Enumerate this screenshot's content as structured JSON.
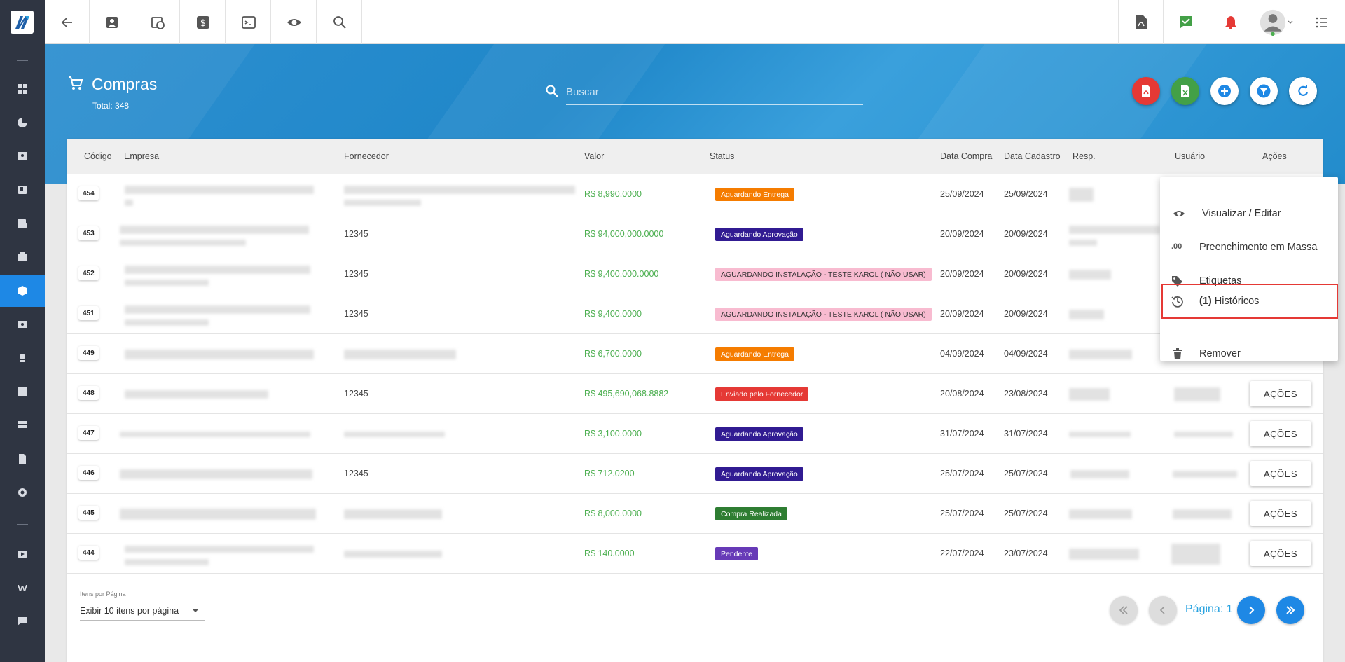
{
  "header": {
    "title": "Compras",
    "total": "Total: 348",
    "search_placeholder": "Buscar"
  },
  "table": {
    "columns": [
      "Código",
      "Empresa",
      "Fornecedor",
      "Valor",
      "Status",
      "Data Compra",
      "Data Cadastro",
      "Resp.",
      "Usuário",
      "Ações"
    ],
    "rows": [
      {
        "code": "454",
        "fornecedor": "",
        "valor": "R$ 8,990.0000",
        "status": "Aguardando Entrega",
        "data_compra": "25/09/2024",
        "data_cadastro": "25/09/2024",
        "acoes": ""
      },
      {
        "code": "453",
        "fornecedor": "12345",
        "valor": "R$ 94,000,000.0000",
        "status": "Aguardando Aprovação",
        "data_compra": "20/09/2024",
        "data_cadastro": "20/09/2024",
        "acoes": ""
      },
      {
        "code": "452",
        "fornecedor": "12345",
        "valor": "R$ 9,400,000.0000",
        "status": "AGUARDANDO INSTALAÇÃO - TESTE KAROL ( NÃO USAR)",
        "data_compra": "20/09/2024",
        "data_cadastro": "20/09/2024",
        "acoes": ""
      },
      {
        "code": "451",
        "fornecedor": "12345",
        "valor": "R$ 9,400.0000",
        "status": "AGUARDANDO INSTALAÇÃO - TESTE KAROL ( NÃO USAR)",
        "data_compra": "20/09/2024",
        "data_cadastro": "20/09/2024",
        "acoes": ""
      },
      {
        "code": "449",
        "fornecedor": "",
        "valor": "R$ 6,700.0000",
        "status": "Aguardando Entrega",
        "data_compra": "04/09/2024",
        "data_cadastro": "04/09/2024",
        "acoes": ""
      },
      {
        "code": "448",
        "fornecedor": "12345",
        "valor": "R$ 495,690,068.8882",
        "status": "Enviado pelo Fornecedor",
        "data_compra": "20/08/2024",
        "data_cadastro": "23/08/2024",
        "acoes": "AÇÕES"
      },
      {
        "code": "447",
        "fornecedor": "",
        "valor": "R$ 3,100.0000",
        "status": "Aguardando Aprovação",
        "data_compra": "31/07/2024",
        "data_cadastro": "31/07/2024",
        "acoes": "AÇÕES"
      },
      {
        "code": "446",
        "fornecedor": "12345",
        "valor": "R$ 712.0200",
        "status": "Aguardando Aprovação",
        "data_compra": "25/07/2024",
        "data_cadastro": "25/07/2024",
        "acoes": "AÇÕES"
      },
      {
        "code": "445",
        "fornecedor": "",
        "valor": "R$ 8,000.0000",
        "status": "Compra Realizada",
        "data_compra": "25/07/2024",
        "data_cadastro": "25/07/2024",
        "acoes": "AÇÕES"
      },
      {
        "code": "444",
        "fornecedor": "",
        "valor": "R$ 140.0000",
        "status": "Pendente",
        "data_compra": "22/07/2024",
        "data_cadastro": "23/07/2024",
        "acoes": "AÇÕES"
      }
    ]
  },
  "status_colors": {
    "Aguardando Entrega": {
      "bg": "#f57c00",
      "fg": "#ffffff"
    },
    "Aguardando Aprovação": {
      "bg": "#311b92",
      "fg": "#ffffff"
    },
    "AGUARDANDO INSTALAÇÃO - TESTE KAROL ( NÃO USAR)": {
      "bg": "#f8bbd0",
      "fg": "#333333"
    },
    "Enviado pelo Fornecedor": {
      "bg": "#e53935",
      "fg": "#ffffff"
    },
    "Compra Realizada": {
      "bg": "#2e7d32",
      "fg": "#ffffff"
    },
    "Pendente": {
      "bg": "#673ab7",
      "fg": "#ffffff"
    }
  },
  "footer": {
    "per_page_label": "Itens por Página",
    "per_page_value": "Exibir 10 itens por página",
    "page_label": "Página: 1"
  },
  "menu": {
    "items": [
      {
        "label": "Visualizar / Editar",
        "icon": "eye-icon"
      },
      {
        "label": "Preenchimento em Massa",
        "icon": "decimal-icon"
      },
      {
        "label": "Etiquetas",
        "icon": "tags-icon"
      },
      {
        "label_bold": "(1)",
        "label": "Históricos",
        "icon": "history-icon"
      },
      {
        "label": "Remover",
        "icon": "trash-icon"
      }
    ]
  },
  "colors": {
    "accent": "#1e88e5",
    "sidebar": "#2f3542",
    "value_green": "#4caf50"
  },
  "icon_text": {
    "decimal_icon": ".00"
  }
}
